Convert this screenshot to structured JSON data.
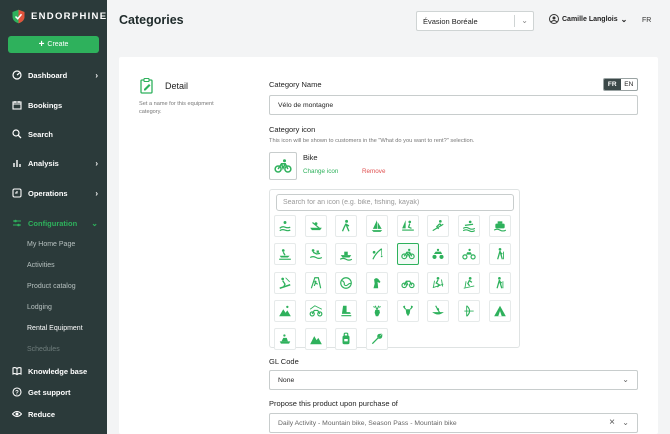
{
  "brand": {
    "name": "ENDORPHINE",
    "accent": "#2eb15c",
    "sidebar_bg": "#2b3a3a"
  },
  "sidebar": {
    "create_label": "Create",
    "items": [
      {
        "label": "Dashboard",
        "icon": "dashboard-icon",
        "chevron": "›"
      },
      {
        "label": "Bookings",
        "icon": "calendar-icon"
      },
      {
        "label": "Search",
        "icon": "search-icon"
      },
      {
        "label": "Analysis",
        "icon": "chart-icon",
        "chevron": "›"
      },
      {
        "label": "Operations",
        "icon": "operations-icon",
        "chevron": "›"
      },
      {
        "label": "Configuration",
        "icon": "sliders-icon",
        "chevron": "⌄"
      }
    ],
    "sub_items": [
      "My Home Page",
      "Activities",
      "Product catalog",
      "Lodging",
      "Rental Equipment",
      "Schedules"
    ],
    "bottom": [
      {
        "label": "Knowledge base",
        "icon": "book-icon"
      },
      {
        "label": "Get support",
        "icon": "help-icon"
      },
      {
        "label": "Reduce",
        "icon": "eye-icon"
      }
    ]
  },
  "header": {
    "title": "Categories",
    "company": "Évasion Boréale",
    "user": "Camille Langlois",
    "language": "FR"
  },
  "detail": {
    "title": "Detail",
    "description": "Set a name for this equipment category."
  },
  "form": {
    "name_label": "Category Name",
    "lang_options": [
      "FR",
      "EN"
    ],
    "name_value": "Vélo de montagne",
    "icon_label": "Category icon",
    "icon_helper": "This icon will be shown to customers in the \"What do you want to rent?\" selection.",
    "selected_icon_name": "Bike",
    "change_icon": "Change icon",
    "remove": "Remove",
    "icon_search_placeholder": "Search for an icon (e.g. bike, fishing, kayak)",
    "gl_label": "GL Code",
    "gl_value": "None",
    "propose_label": "Propose this product upon purchase of",
    "propose_value": "Daily Activity - Mountain bike, Season Pass - Mountain bike"
  },
  "icon_grid": [
    "swimmer-icon",
    "kayak-icon",
    "hiker-icon",
    "sailboat-icon",
    "windsurf-icon",
    "skier-icon",
    "waves-icon",
    "ferry-icon",
    "jetski-icon",
    "scuba-icon",
    "boat-icon",
    "fishing-icon",
    "bike-icon",
    "atv-icon",
    "motorcycle-icon",
    "trekking-icon",
    "snowboard-icon",
    "climbing-icon",
    "globe-icon",
    "horse-icon",
    "bicycle-icon",
    "downhill-ski-icon",
    "ski-touring-icon",
    "walker-icon",
    "mountain-hiker-icon",
    "mountain-bike-icon",
    "ice-skate-icon",
    "deer-icon",
    "moose-icon",
    "canoe-icon",
    "archery-icon",
    "tent-icon",
    "snowmobile-icon",
    "mountains-icon",
    "backpack-icon",
    "tools-icon"
  ],
  "selected_icon_index": 12
}
